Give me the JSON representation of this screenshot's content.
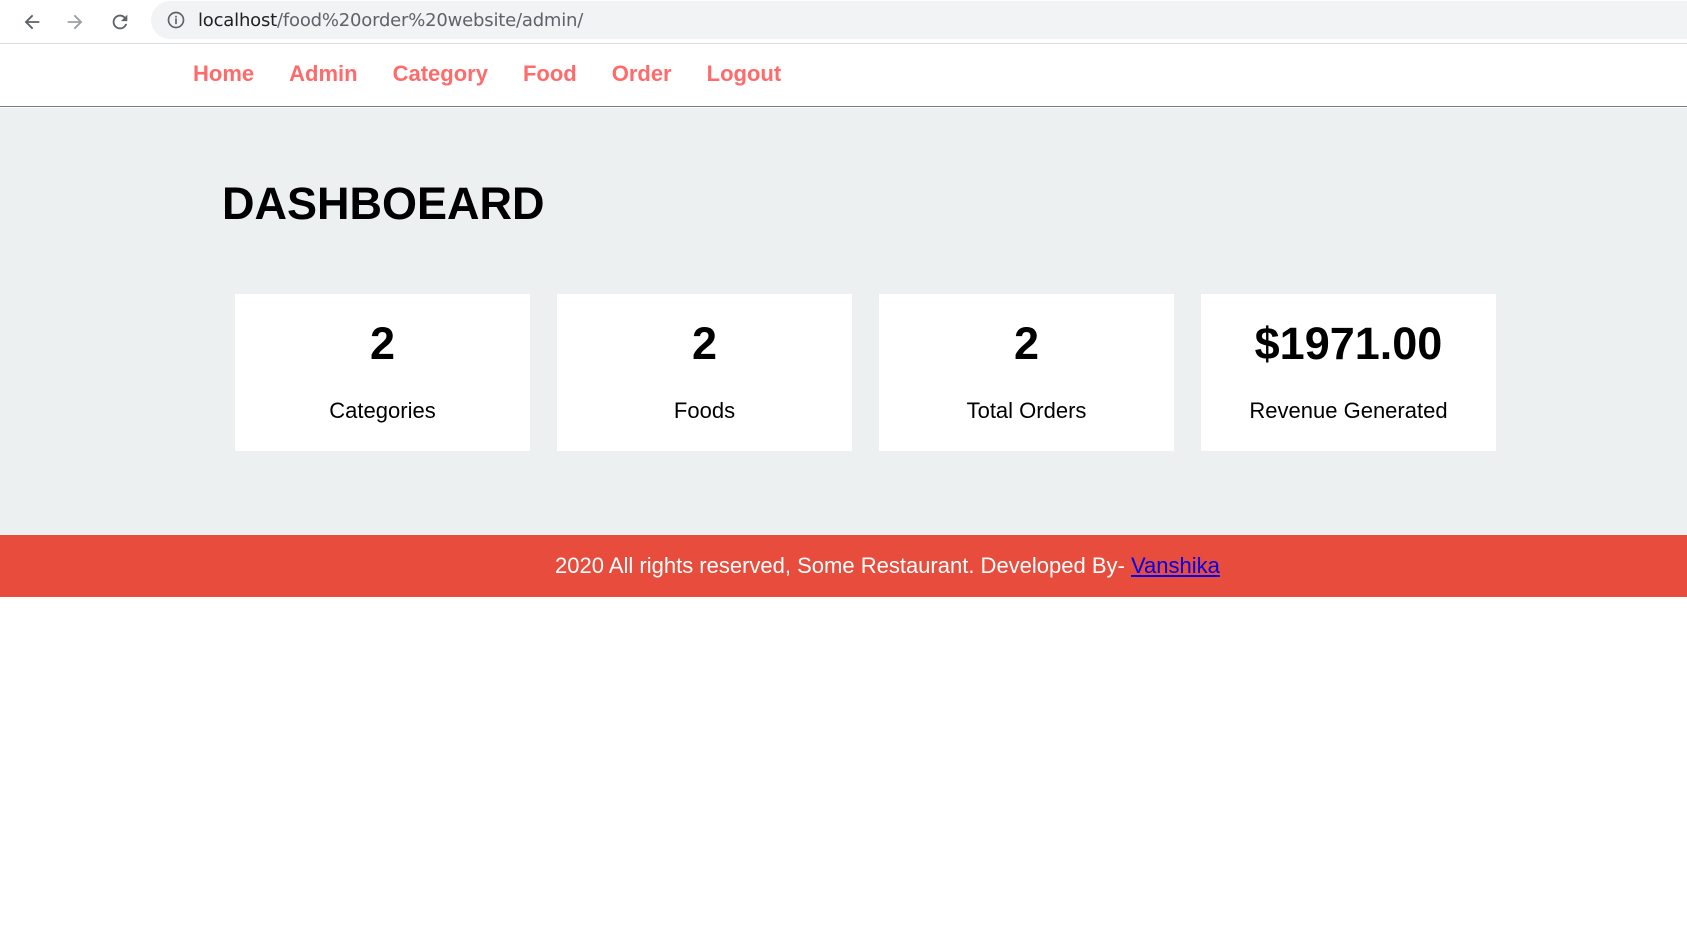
{
  "browser": {
    "url_host": "localhost",
    "url_path": "/food%20order%20website/admin/"
  },
  "menu": {
    "items": [
      {
        "label": "Home"
      },
      {
        "label": "Admin"
      },
      {
        "label": "Category"
      },
      {
        "label": "Food"
      },
      {
        "label": "Order"
      },
      {
        "label": "Logout"
      }
    ]
  },
  "main": {
    "title": "DASHBOEARD",
    "cards": [
      {
        "value": "2",
        "label": "Categories"
      },
      {
        "value": "2",
        "label": "Foods"
      },
      {
        "value": "2",
        "label": "Total Orders"
      },
      {
        "value": "$1971.00",
        "label": "Revenue Generated"
      }
    ]
  },
  "footer": {
    "text": "2020 All rights reserved, Some Restaurant. Developed By- ",
    "link_label": "Vanshika"
  },
  "colors": {
    "menu_link": "#ff6b6b",
    "main_bg": "#ecf0f1",
    "footer_bg": "#e74c3c"
  }
}
